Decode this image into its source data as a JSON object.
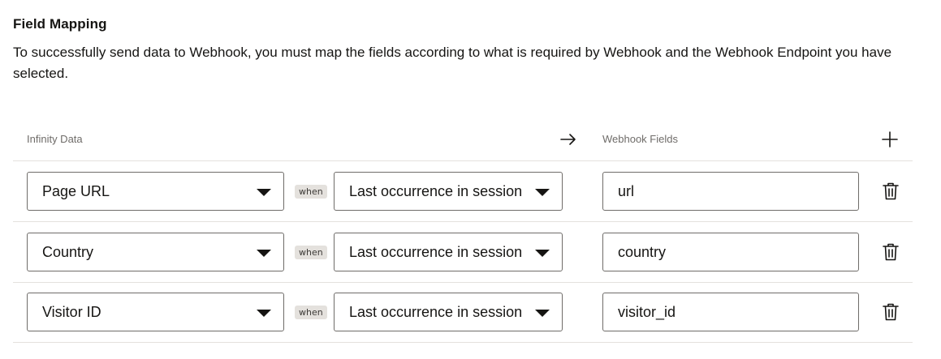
{
  "section": {
    "title": "Field Mapping",
    "description": "To successfully send data to Webhook, you must map the fields according to what is required by Webhook and the Webhook Endpoint you have selected."
  },
  "table": {
    "infinity_label": "Infinity Data",
    "webhook_label": "Webhook Fields",
    "icons": {
      "arrow": "arrow-right-icon",
      "add": "plus-icon",
      "delete": "trash-icon",
      "dropdown": "caret-down-icon"
    },
    "rows": [
      {
        "field": "Page URL",
        "when": "when",
        "occurrence": "Last occurrence in session",
        "webhook_field": "url"
      },
      {
        "field": "Country",
        "when": "when",
        "occurrence": "Last occurrence in session",
        "webhook_field": "country"
      },
      {
        "field": "Visitor ID",
        "when": "when",
        "occurrence": "Last occurrence in session",
        "webhook_field": "visitor_id"
      }
    ]
  }
}
